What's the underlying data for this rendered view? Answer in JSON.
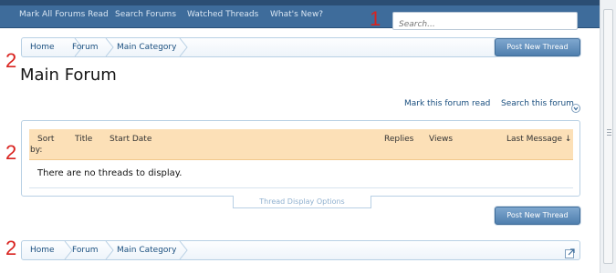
{
  "nav": {
    "links": [
      "Mark All Forums Read",
      "Search Forums",
      "Watched Threads",
      "What's New?"
    ]
  },
  "search": {
    "placeholder": "Search..."
  },
  "annotations": {
    "one": "1",
    "two": "2"
  },
  "breadcrumb": {
    "items": [
      "Home",
      "Forum",
      "Main Category"
    ],
    "jump_icon": "external-link-icon"
  },
  "actions": {
    "post_new_thread": "Post New Thread",
    "mark_read": "Mark this forum read",
    "search_forum": "Search this forum"
  },
  "forum": {
    "title": "Main Forum"
  },
  "threads": {
    "columns": {
      "sort_line1": "Sort",
      "sort_line2": "by:",
      "title": "Title",
      "start_date": "Start Date",
      "replies": "Replies",
      "views": "Views",
      "last_message": "Last Message ↓"
    },
    "empty_message": "There are no threads to display.",
    "display_options": "Thread Display Options"
  },
  "colors": {
    "nav_bg": "#3e6c9b",
    "accent_link": "#1a4f7f",
    "header_bg": "#fce0b7",
    "annotation_red": "#d9231f"
  }
}
